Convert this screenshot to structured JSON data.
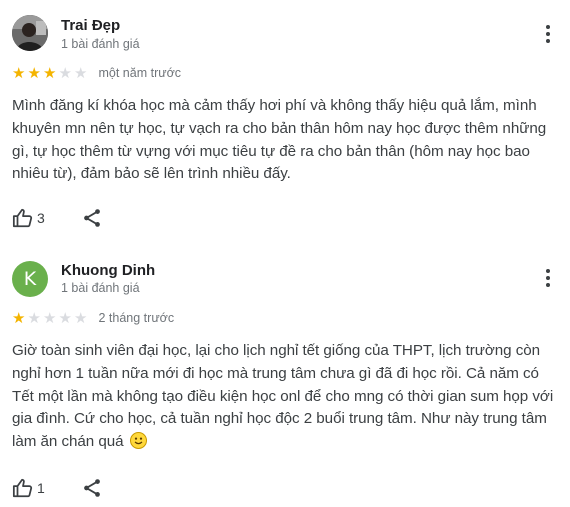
{
  "reviews": [
    {
      "name": "Trai Đẹp",
      "meta": "1 bài đánh giá",
      "rating": 3,
      "time": "một năm trước",
      "text": "Mình đăng kí khóa học mà cảm thấy hơi phí và không thấy hiệu quả lắm, mình khuyên mn nên tự học, tự vạch ra cho bản thân hôm nay học được thêm những gì, tự học thêm từ vựng với mục tiêu tự đề ra cho bản thân (hôm nay học bao nhiêu từ), đảm bảo sẽ lên trình nhiều đấy.",
      "likes": "3"
    },
    {
      "name": "Khuong Dinh",
      "avatar_letter": "K",
      "meta": "1 bài đánh giá",
      "rating": 1,
      "time": "2 tháng trước",
      "text": "Giờ toàn sinh viên đại học, lại cho lịch nghỉ tết giống của THPT, lịch trường còn nghỉ hơn 1 tuần nữa mới đi học mà trung tâm chưa gì đã đi học rồi. Cả năm có Tết một lần mà không tạo điều kiện học onl để cho mng có thời gian sum họp với gia đình. Cứ cho học, cả tuần nghỉ học độc 2 buổi trung tâm. Như này trung tâm làm ăn chán quá",
      "likes": "1"
    }
  ],
  "colors": {
    "star_on": "#f4b400",
    "star_off": "#dadce0",
    "avatar_k": "#6ab04c"
  },
  "icons": [
    "more-vert-icon",
    "thumb-up-icon",
    "share-icon",
    "smiley-emoji-icon"
  ]
}
